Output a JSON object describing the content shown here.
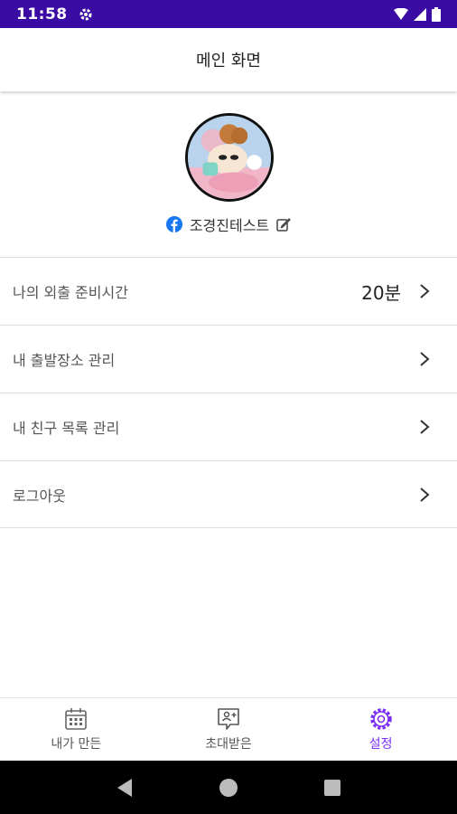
{
  "status_bar": {
    "time": "11:58",
    "icons": [
      "settings-icon",
      "wifi-icon",
      "signal-icon",
      "battery-icon"
    ],
    "background": "#3a0ca3"
  },
  "app_bar": {
    "title": "메인 화면"
  },
  "profile": {
    "name": "조경진테스트",
    "login_icon": "facebook-icon",
    "edit_icon": "edit-icon"
  },
  "menu": {
    "items": [
      {
        "label": "나의 외출 준비시간",
        "value": "20분"
      },
      {
        "label": "내 출발장소 관리",
        "value": ""
      },
      {
        "label": "내 친구 목록 관리",
        "value": ""
      },
      {
        "label": "로그아웃",
        "value": ""
      }
    ]
  },
  "bottom_nav": {
    "tabs": [
      {
        "label": "내가 만든",
        "icon": "calendar-icon",
        "active": false
      },
      {
        "label": "초대받은",
        "icon": "invite-icon",
        "active": false
      },
      {
        "label": "설정",
        "icon": "settings-icon",
        "active": true
      }
    ],
    "active_color": "#7b2ff7"
  },
  "system_nav": {
    "buttons": [
      "back-icon",
      "home-icon",
      "recents-icon"
    ]
  }
}
